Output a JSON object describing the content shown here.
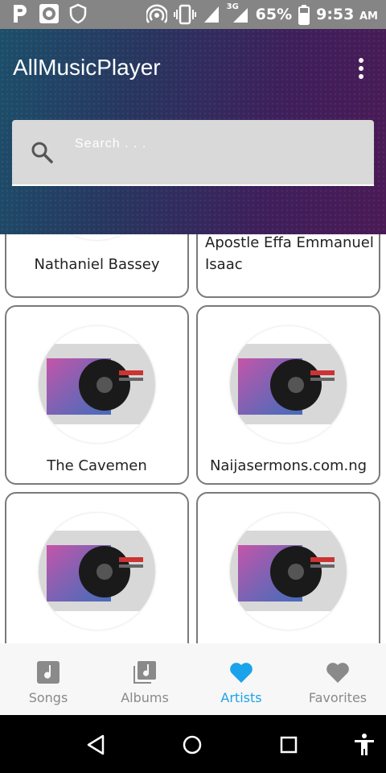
{
  "status_bar": {
    "battery": "65%",
    "network": "3G",
    "time": "9:53",
    "ampm": "AM",
    "icons": [
      "p-icon",
      "record-icon",
      "shield-icon",
      "hotspot-icon",
      "vibrate-icon",
      "signal-icon",
      "battery-icon"
    ]
  },
  "app": {
    "title": "AllMusicPlayer"
  },
  "search": {
    "placeholder": "Search . . ."
  },
  "artists": [
    {
      "name": "Nathaniel Bassey"
    },
    {
      "name": "Apostle Effa Emmanuel Isaac"
    },
    {
      "name": "The Cavemen"
    },
    {
      "name": "Naijasermons.com.ng"
    },
    {
      "name": ""
    },
    {
      "name": ""
    }
  ],
  "tabs": [
    {
      "label": "Songs",
      "icon": "music-note-icon",
      "active": false
    },
    {
      "label": "Albums",
      "icon": "album-icon",
      "active": false
    },
    {
      "label": "Artists",
      "icon": "heart-icon",
      "active": true
    },
    {
      "label": "Favorites",
      "icon": "heart-icon",
      "active": false
    }
  ],
  "colors": {
    "accent": "#1aa3ea",
    "inactive": "#8a8a8a",
    "header_start": "#1c4f6a",
    "header_end": "#4a1a55"
  }
}
